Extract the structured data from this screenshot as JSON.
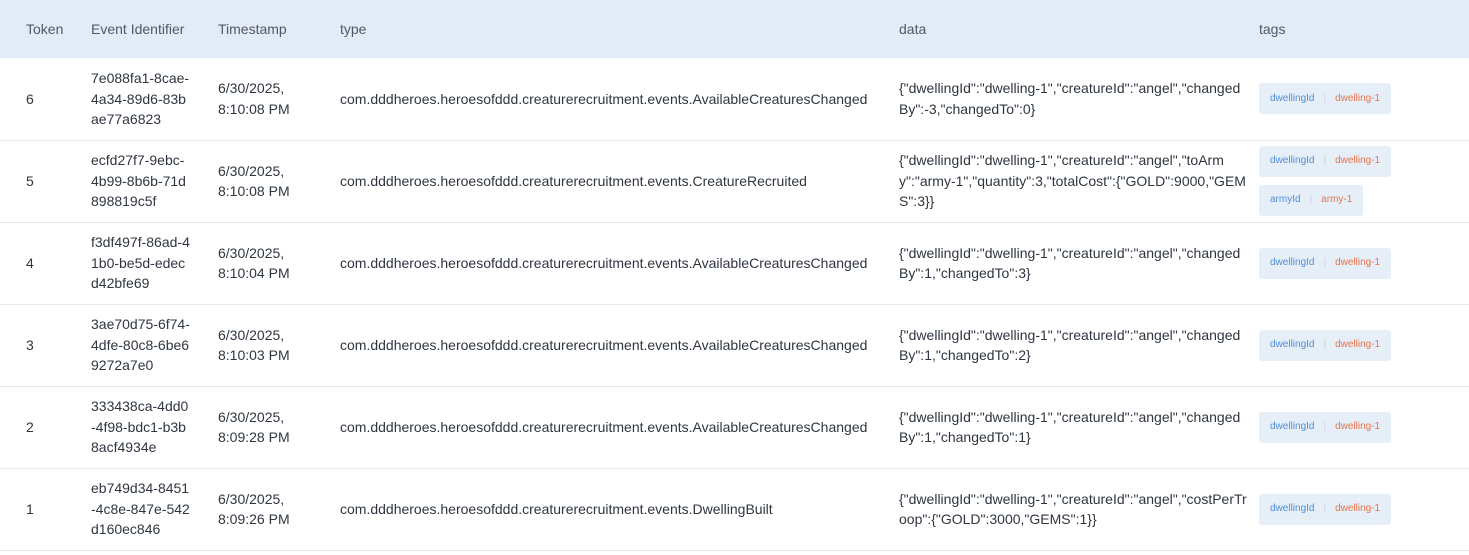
{
  "table": {
    "headers": {
      "token": "Token",
      "event_identifier": "Event Identifier",
      "timestamp": "Timestamp",
      "type": "type",
      "data": "data",
      "tags": "tags"
    },
    "rows": [
      {
        "token": "6",
        "event_id": "7e088fa1-8cae-4a34-89d6-83bae77a6823",
        "timestamp_date": "6/30/2025,",
        "timestamp_time": "8:10:08 PM",
        "type": "com.dddheroes.heroesofddd.creaturerecruitment.events.AvailableCreaturesChanged",
        "data": "{\"dwellingId\":\"dwelling-1\",\"creatureId\":\"angel\",\"changedBy\":-3,\"changedTo\":0}",
        "tags": [
          {
            "key": "dwellingId",
            "value": "dwelling-1"
          }
        ]
      },
      {
        "token": "5",
        "event_id": "ecfd27f7-9ebc-4b99-8b6b-71d898819c5f",
        "timestamp_date": "6/30/2025,",
        "timestamp_time": "8:10:08 PM",
        "type": "com.dddheroes.heroesofddd.creaturerecruitment.events.CreatureRecruited",
        "data": "{\"dwellingId\":\"dwelling-1\",\"creatureId\":\"angel\",\"toArmy\":\"army-1\",\"quantity\":3,\"totalCost\":{\"GOLD\":9000,\"GEMS\":3}}",
        "tags": [
          {
            "key": "dwellingId",
            "value": "dwelling-1"
          },
          {
            "key": "armyId",
            "value": "army-1"
          }
        ]
      },
      {
        "token": "4",
        "event_id": "f3df497f-86ad-41b0-be5d-edecd42bfe69",
        "timestamp_date": "6/30/2025,",
        "timestamp_time": "8:10:04 PM",
        "type": "com.dddheroes.heroesofddd.creaturerecruitment.events.AvailableCreaturesChanged",
        "data": "{\"dwellingId\":\"dwelling-1\",\"creatureId\":\"angel\",\"changedBy\":1,\"changedTo\":3}",
        "tags": [
          {
            "key": "dwellingId",
            "value": "dwelling-1"
          }
        ]
      },
      {
        "token": "3",
        "event_id": "3ae70d75-6f74-4dfe-80c8-6be69272a7e0",
        "timestamp_date": "6/30/2025,",
        "timestamp_time": "8:10:03 PM",
        "type": "com.dddheroes.heroesofddd.creaturerecruitment.events.AvailableCreaturesChanged",
        "data": "{\"dwellingId\":\"dwelling-1\",\"creatureId\":\"angel\",\"changedBy\":1,\"changedTo\":2}",
        "tags": [
          {
            "key": "dwellingId",
            "value": "dwelling-1"
          }
        ]
      },
      {
        "token": "2",
        "event_id": "333438ca-4dd0-4f98-bdc1-b3b8acf4934e",
        "timestamp_date": "6/30/2025,",
        "timestamp_time": "8:09:28 PM",
        "type": "com.dddheroes.heroesofddd.creaturerecruitment.events.AvailableCreaturesChanged",
        "data": "{\"dwellingId\":\"dwelling-1\",\"creatureId\":\"angel\",\"changedBy\":1,\"changedTo\":1}",
        "tags": [
          {
            "key": "dwellingId",
            "value": "dwelling-1"
          }
        ]
      },
      {
        "token": "1",
        "event_id": "eb749d34-8451-4c8e-847e-542d160ec846",
        "timestamp_date": "6/30/2025,",
        "timestamp_time": "8:09:26 PM",
        "type": "com.dddheroes.heroesofddd.creaturerecruitment.events.DwellingBuilt",
        "data": "{\"dwellingId\":\"dwelling-1\",\"creatureId\":\"angel\",\"costPerTroop\":{\"GOLD\":3000,\"GEMS\":1}}",
        "tags": [
          {
            "key": "dwellingId",
            "value": "dwelling-1"
          }
        ]
      }
    ]
  },
  "colors": {
    "header_bg": "#e3ebf6",
    "tag_bg": "#e6eef8",
    "tag_key": "#4d8fd6",
    "tag_value": "#e8734a"
  }
}
